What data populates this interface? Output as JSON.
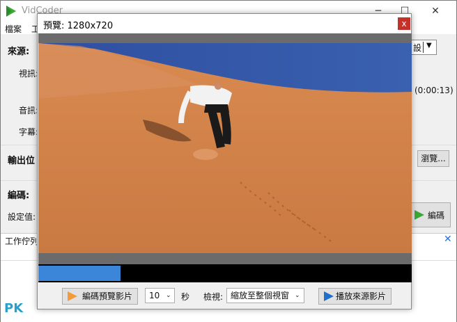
{
  "main_window": {
    "title": "VidCoder",
    "controls": {
      "minimize": "─",
      "maximize": "☐",
      "close": "✕"
    },
    "menu": [
      "檔案",
      "工"
    ],
    "source_label": "來源:",
    "video_label": "視訊:",
    "audio_label": "音訊:",
    "subtitle_label": "字幕:",
    "duration": "(0:00:13)",
    "preset_partial": "設",
    "output_label": "輸出位",
    "browse_button": "瀏覽...",
    "encoding_label": "編碼:",
    "settings_label": "設定值:",
    "encode_button": "編碼",
    "queue_label": "工作佇列",
    "queue_close": "✕"
  },
  "preview_window": {
    "title": "預覽: 1280x720",
    "close": "x",
    "slider_progress": 0.22,
    "encode_preview_button": "編碼預覽影片",
    "seconds_value": "10",
    "seconds_unit": "秒",
    "view_label": "檢視:",
    "view_option": "縮放至整個視窗",
    "play_source_button": "播放來源影片"
  },
  "colors": {
    "accent": "#3b86d9",
    "close_red": "#c4312b",
    "play_green": "#3aa835",
    "play_orange": "#f39a3a",
    "play_blue": "#1e6fc9",
    "sky": "#3355a8",
    "sand": "#d98a50"
  },
  "watermark": "PK"
}
